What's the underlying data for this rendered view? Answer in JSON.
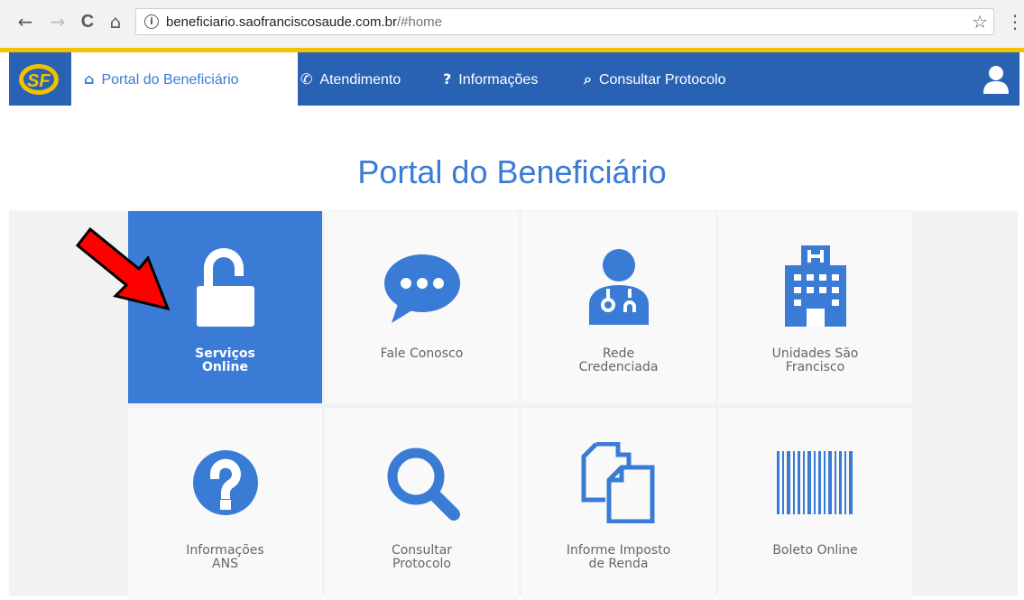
{
  "browser": {
    "back_glyph": "←",
    "forward_glyph": "→",
    "reload_glyph": "C",
    "home_glyph": "⌂",
    "info_glyph": "i",
    "url_host": "beneficiario.saofranciscosaude.com.br",
    "url_path": "/#home",
    "star_glyph": "☆",
    "menu_glyph": "⋮"
  },
  "colors": {
    "brand": "#2a62b3",
    "accent": "#3a7bd5",
    "tile": "#f9f9f9",
    "yellow": "#f2c200",
    "arrow": "#ff0000"
  },
  "navbar": {
    "logo_icon": "sf-logo-icon",
    "items": [
      {
        "icon": "home-icon",
        "glyph": "⌂",
        "label": "Portal do Beneficiário"
      },
      {
        "icon": "phone-icon",
        "glyph": "✆",
        "label": "Atendimento"
      },
      {
        "icon": "question-icon",
        "glyph": "?",
        "label": "Informações"
      },
      {
        "icon": "search-icon",
        "glyph": "⌕",
        "label": "Consultar Protocolo"
      }
    ],
    "user_icon": "user-icon"
  },
  "main": {
    "title": "Portal do Beneficiário",
    "tiles": [
      {
        "icon": "unlock-icon",
        "label": "Serviços\nOnline"
      },
      {
        "icon": "chat-bubble-icon",
        "label": "Fale Conosco"
      },
      {
        "icon": "doctor-icon",
        "label": "Rede\nCredenciada"
      },
      {
        "icon": "hospital-icon",
        "label": "Unidades São\nFrancisco"
      },
      {
        "icon": "question-circle-icon",
        "label": "Informações\nANS"
      },
      {
        "icon": "magnifier-icon",
        "label": "Consultar\nProtocolo"
      },
      {
        "icon": "copy-documents-icon",
        "label": "Informe Imposto\nde Renda"
      },
      {
        "icon": "barcode-icon",
        "label": "Boleto Online"
      }
    ]
  }
}
